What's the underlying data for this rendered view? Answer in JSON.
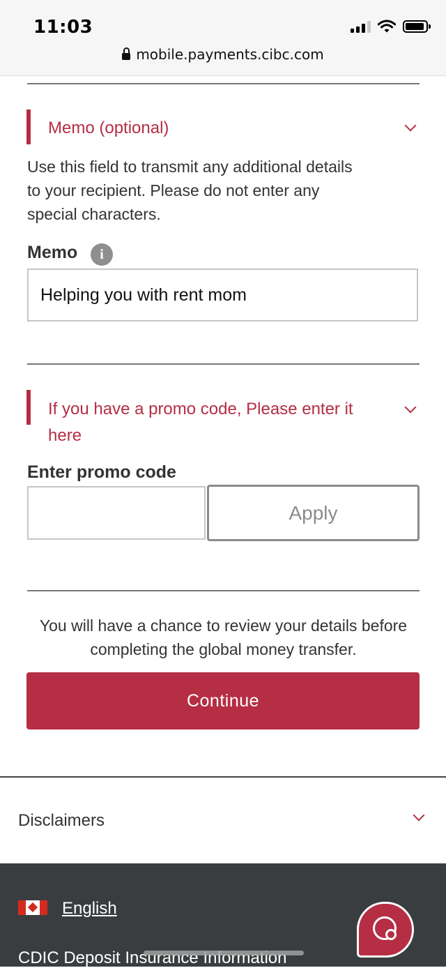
{
  "status_bar": {
    "time": "11:03",
    "url": "mobile.payments.cibc.com"
  },
  "memo_section": {
    "title": "Memo (optional)",
    "description": "Use this field to transmit any additional details to your recipient. Please do not enter any special characters.",
    "field_label": "Memo",
    "info_glyph": "i",
    "value": "Helping you with rent mom"
  },
  "promo_section": {
    "title": "If you have a promo code, Please enter it here",
    "field_label": "Enter promo code",
    "value": "",
    "apply_label": "Apply"
  },
  "review_note": "You will have a chance to review your details before completing the global money transfer.",
  "continue_label": "Continue",
  "disclaimers_label": "Disclaimers",
  "footer": {
    "language_label": "English",
    "cdic_label": "CDIC Deposit Insurance Information"
  },
  "colors": {
    "accent": "#b52e44",
    "footer_bg": "#3a3d40"
  },
  "icons": [
    "lock-icon",
    "signal-icon",
    "wifi-icon",
    "battery-icon",
    "chevron-down-icon",
    "info-icon",
    "canada-flag-icon",
    "chat-icon"
  ]
}
